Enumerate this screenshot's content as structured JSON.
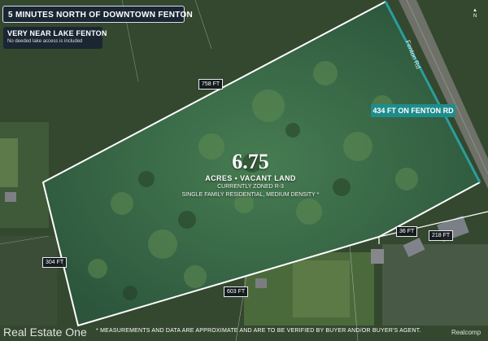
{
  "header": {
    "title": "5 MINUTES NORTH OF DOWNTOWN FENTON",
    "lake_title": "VERY NEAR LAKE FENTON",
    "lake_note": "No deeded lake access is included"
  },
  "parcel": {
    "acreage": "6.75",
    "acres_line": "ACRES  •  VACANT LAND",
    "zoning_line_1": "CURRENTLY ZONED R-3",
    "zoning_line_2": "SINGLE FAMILY RESIDENTIAL, MEDIUM DENSITY *",
    "frontage_label": "434 FT ON FENTON RD"
  },
  "dimensions": {
    "north_edge": "758 FT",
    "west_edge": "304 FT",
    "south_edge": "603 FT",
    "small_jog": "36 FT",
    "southeast_edge": "218 FT"
  },
  "map": {
    "road_label": "Fenton Rd",
    "north_marker": "N",
    "colors": {
      "parcel_outline": "#ffffff",
      "frontage_line": "#2a9d9d",
      "frontage_badge": "#1f8c8c",
      "label_bg": "#12161c",
      "tree_canopy": "#3f6b3c"
    }
  },
  "footer": {
    "brand_left": "Real Estate One",
    "disclaimer": "* MEASUREMENTS AND DATA ARE APPROXIMATE AND ARE TO BE VERIFIED BY BUYER AND/OR BUYER'S AGENT.",
    "brand_right": "Realcomp"
  }
}
